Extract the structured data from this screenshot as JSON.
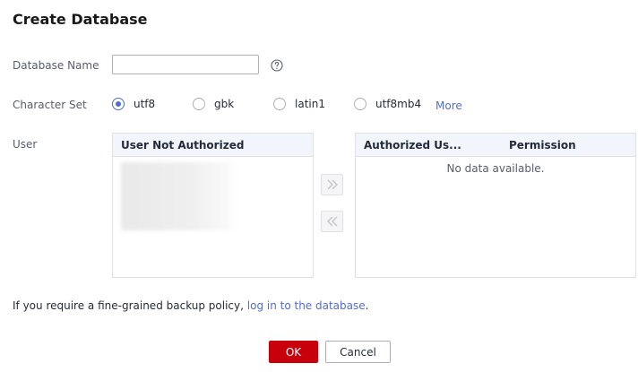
{
  "dialog": {
    "title": "Create Database"
  },
  "form": {
    "database_name_label": "Database Name",
    "database_name_value": "",
    "database_name_placeholder": "",
    "character_set_label": "Character Set",
    "character_set_options": [
      {
        "label": "utf8",
        "selected": true
      },
      {
        "label": "gbk",
        "selected": false
      },
      {
        "label": "latin1",
        "selected": false
      },
      {
        "label": "utf8mb4",
        "selected": false
      }
    ],
    "more_label": "More",
    "user_label": "User"
  },
  "user_transfer": {
    "left_header": "User Not Authorized",
    "right_header_authorized": "Authorized Us...",
    "right_header_permission": "Permission",
    "empty_text": "No data available.",
    "add_icon": "double-chevron-right-icon",
    "remove_icon": "double-chevron-left-icon"
  },
  "footer": {
    "note_text": "If you require a fine-grained backup policy, ",
    "note_link": "log in to the database",
    "note_end": ".",
    "ok_label": "OK",
    "cancel_label": "Cancel"
  },
  "colors": {
    "accent": "#526ecc",
    "primary_button": "#c7000b"
  }
}
